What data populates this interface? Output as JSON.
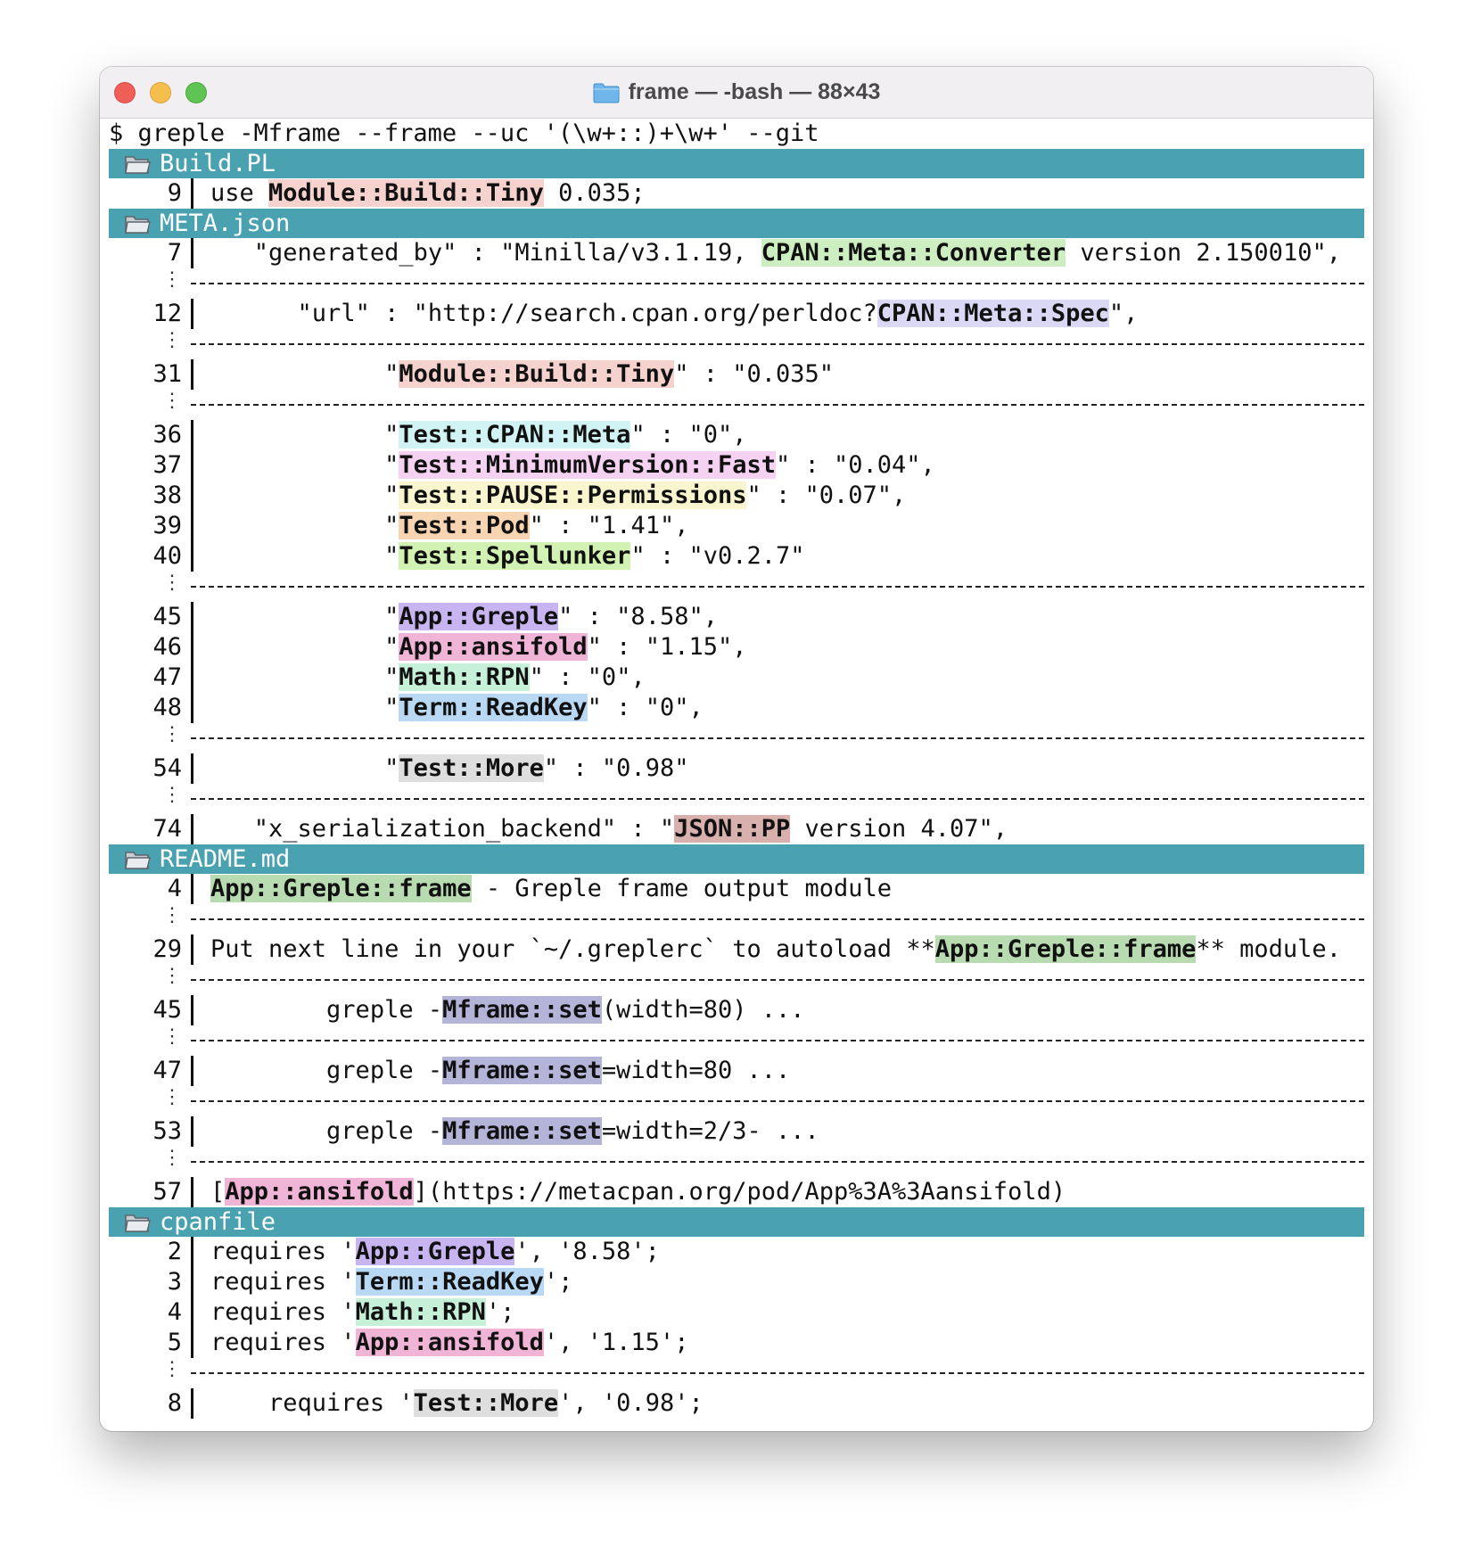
{
  "window": {
    "title": "frame — -bash — 88×43"
  },
  "command": "$ greple -Mframe --frame --uc '(\\w+::)+\\w+' --git",
  "sep_mark": "⋮",
  "files": [
    {
      "name": "Build.PL",
      "rows": [
        {
          "n": "9",
          "indent": 0,
          "parts": [
            [
              "use ",
              null
            ],
            [
              "Module::Build::Tiny",
              "rose"
            ],
            [
              " 0.035;",
              null
            ]
          ]
        }
      ]
    },
    {
      "name": "META.json",
      "rows": [
        {
          "n": "7",
          "indent": 3,
          "parts": [
            [
              "\"generated_by\" : \"Minilla/v3.1.19, ",
              null
            ],
            [
              "CPAN::Meta::Converter",
              "green"
            ],
            [
              " version 2.150010\",",
              null
            ]
          ]
        },
        {
          "sep": true
        },
        {
          "n": "12",
          "indent": 6,
          "parts": [
            [
              "\"url\" : \"http://search.cpan.org/perldoc?",
              null
            ],
            [
              "CPAN::Meta::Spec",
              "lav"
            ],
            [
              "\",",
              null
            ]
          ]
        },
        {
          "sep": true
        },
        {
          "n": "31",
          "indent": 12,
          "parts": [
            [
              "\"",
              null
            ],
            [
              "Module::Build::Tiny",
              "rose"
            ],
            [
              "\" : \"0.035\"",
              null
            ]
          ]
        },
        {
          "sep": true
        },
        {
          "n": "36",
          "indent": 12,
          "parts": [
            [
              "\"",
              null
            ],
            [
              "Test::CPAN::Meta",
              "cyan"
            ],
            [
              "\" : \"0\",",
              null
            ]
          ]
        },
        {
          "n": "37",
          "indent": 12,
          "parts": [
            [
              "\"",
              null
            ],
            [
              "Test::MinimumVersion::Fast",
              "pink"
            ],
            [
              "\" : \"0.04\",",
              null
            ]
          ]
        },
        {
          "n": "38",
          "indent": 12,
          "parts": [
            [
              "\"",
              null
            ],
            [
              "Test::PAUSE::Permissions",
              "yellow"
            ],
            [
              "\" : \"0.07\",",
              null
            ]
          ]
        },
        {
          "n": "39",
          "indent": 12,
          "parts": [
            [
              "\"",
              null
            ],
            [
              "Test::Pod",
              "orange"
            ],
            [
              "\" : \"1.41\",",
              null
            ]
          ]
        },
        {
          "n": "40",
          "indent": 12,
          "parts": [
            [
              "\"",
              null
            ],
            [
              "Test::Spellunker",
              "lime"
            ],
            [
              "\" : \"v0.2.7\"",
              null
            ]
          ]
        },
        {
          "sep": true
        },
        {
          "n": "45",
          "indent": 12,
          "parts": [
            [
              "\"",
              null
            ],
            [
              "App::Greple",
              "purple"
            ],
            [
              "\" : \"8.58\",",
              null
            ]
          ]
        },
        {
          "n": "46",
          "indent": 12,
          "parts": [
            [
              "\"",
              null
            ],
            [
              "App::ansifold",
              "magenta"
            ],
            [
              "\" : \"1.15\",",
              null
            ]
          ]
        },
        {
          "n": "47",
          "indent": 12,
          "parts": [
            [
              "\"",
              null
            ],
            [
              "Math::RPN",
              "mint"
            ],
            [
              "\" : \"0\",",
              null
            ]
          ]
        },
        {
          "n": "48",
          "indent": 12,
          "parts": [
            [
              "\"",
              null
            ],
            [
              "Term::ReadKey",
              "blue"
            ],
            [
              "\" : \"0\",",
              null
            ]
          ]
        },
        {
          "sep": true
        },
        {
          "n": "54",
          "indent": 12,
          "parts": [
            [
              "\"",
              null
            ],
            [
              "Test::More",
              "gray"
            ],
            [
              "\" : \"0.98\"",
              null
            ]
          ]
        },
        {
          "sep": true
        },
        {
          "n": "74",
          "indent": 3,
          "parts": [
            [
              "\"x_serialization_backend\" : \"",
              null
            ],
            [
              "JSON::PP",
              "brown"
            ],
            [
              " version 4.07\",",
              null
            ]
          ]
        }
      ]
    },
    {
      "name": "README.md",
      "rows": [
        {
          "n": "4",
          "indent": 0,
          "parts": [
            [
              "App::Greple::frame",
              "sage"
            ],
            [
              " - Greple frame output module",
              null
            ]
          ]
        },
        {
          "sep": true
        },
        {
          "n": "29",
          "indent": 0,
          "parts": [
            [
              "Put next line in your `~/.greplerc` to autoload **",
              null
            ],
            [
              "App::Greple::frame",
              "sage"
            ],
            [
              "** module.",
              null
            ]
          ]
        },
        {
          "sep": true
        },
        {
          "n": "45",
          "indent": 8,
          "parts": [
            [
              "greple -",
              null
            ],
            [
              "Mframe::set",
              "slate"
            ],
            [
              "(width=80) ...",
              null
            ]
          ]
        },
        {
          "sep": true
        },
        {
          "n": "47",
          "indent": 8,
          "parts": [
            [
              "greple -",
              null
            ],
            [
              "Mframe::set",
              "slate"
            ],
            [
              "=width=80 ...",
              null
            ]
          ]
        },
        {
          "sep": true
        },
        {
          "n": "53",
          "indent": 8,
          "parts": [
            [
              "greple -",
              null
            ],
            [
              "Mframe::set",
              "slate"
            ],
            [
              "=width=2/3- ...",
              null
            ]
          ]
        },
        {
          "sep": true
        },
        {
          "n": "57",
          "indent": 0,
          "parts": [
            [
              "[",
              null
            ],
            [
              "App::ansifold",
              "magenta"
            ],
            [
              "](https://metacpan.org/pod/App%3A%3Aansifold)",
              null
            ]
          ]
        }
      ]
    },
    {
      "name": "cpanfile",
      "rows": [
        {
          "n": "2",
          "indent": 0,
          "parts": [
            [
              "requires '",
              null
            ],
            [
              "App::Greple",
              "purple"
            ],
            [
              "', '8.58';",
              null
            ]
          ]
        },
        {
          "n": "3",
          "indent": 0,
          "parts": [
            [
              "requires '",
              null
            ],
            [
              "Term::ReadKey",
              "blue"
            ],
            [
              "';",
              null
            ]
          ]
        },
        {
          "n": "4",
          "indent": 0,
          "parts": [
            [
              "requires '",
              null
            ],
            [
              "Math::RPN",
              "mint"
            ],
            [
              "';",
              null
            ]
          ]
        },
        {
          "n": "5",
          "indent": 0,
          "parts": [
            [
              "requires '",
              null
            ],
            [
              "App::ansifold",
              "magenta"
            ],
            [
              "', '1.15';",
              null
            ]
          ]
        },
        {
          "sep": true
        },
        {
          "n": "8",
          "indent": 4,
          "parts": [
            [
              "requires '",
              null
            ],
            [
              "Test::More",
              "gray"
            ],
            [
              "', '0.98';",
              null
            ]
          ]
        }
      ]
    }
  ]
}
